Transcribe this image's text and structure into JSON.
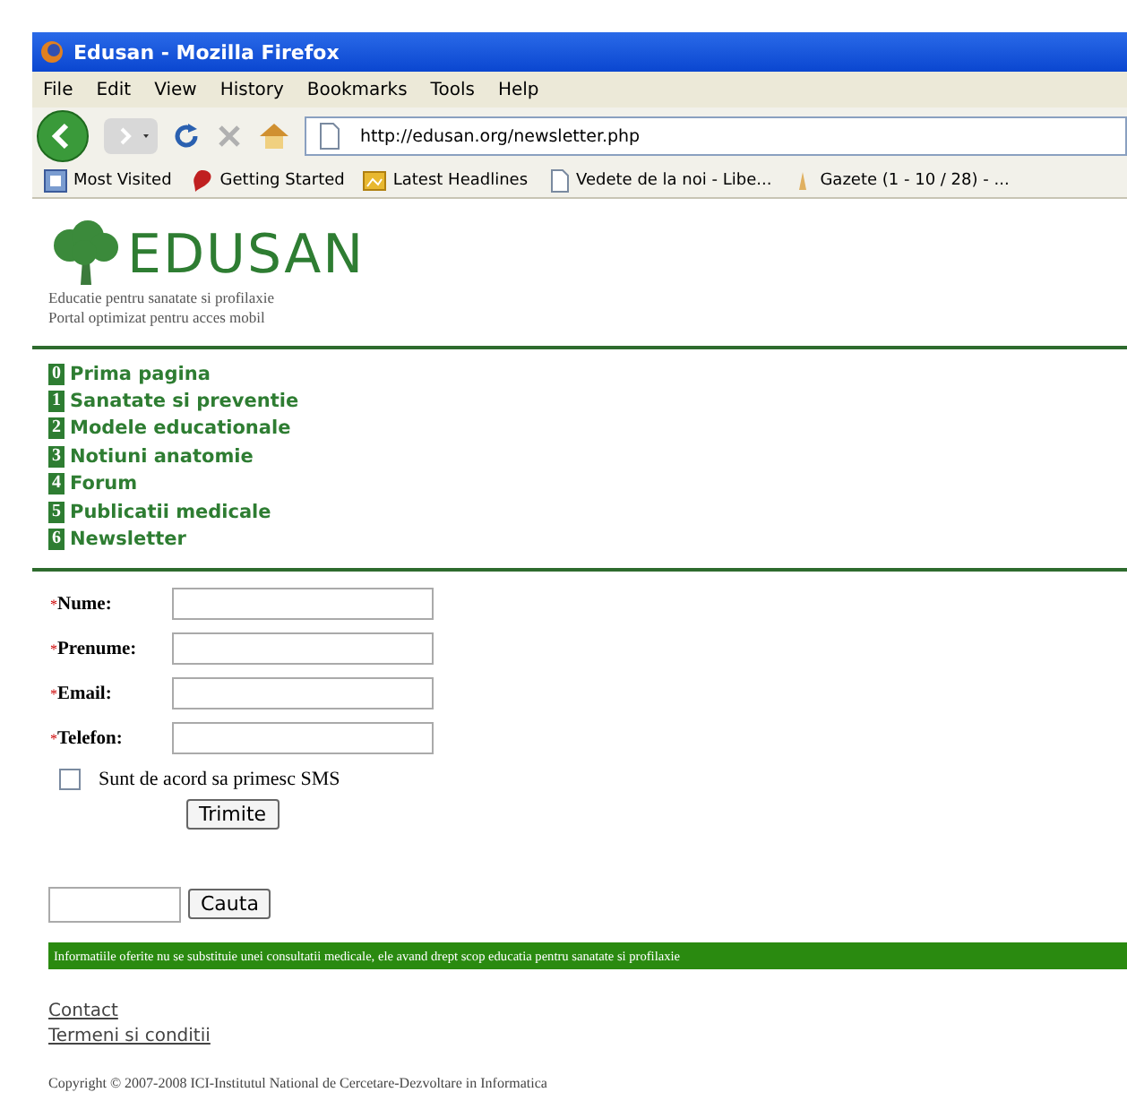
{
  "window": {
    "title": "Edusan - Mozilla Firefox"
  },
  "menu": [
    "File",
    "Edit",
    "View",
    "History",
    "Bookmarks",
    "Tools",
    "Help"
  ],
  "address": {
    "value": "http://edusan.org/newsletter.php"
  },
  "bookmarks": [
    {
      "label": "Most Visited",
      "kind": "smart"
    },
    {
      "label": "Getting Started",
      "kind": "star"
    },
    {
      "label": "Latest Headlines",
      "kind": "feed"
    },
    {
      "label": "Vedete de la noi - Libe...",
      "kind": "page"
    },
    {
      "label": "Gazete (1 - 10 / 28) - ...",
      "kind": "search"
    }
  ],
  "site": {
    "logo": "EDUSAN",
    "taglines": [
      "Educatie pentru sanatate si profilaxie",
      "Portal optimizat pentru acces mobil"
    ]
  },
  "nav": [
    {
      "number": "0",
      "label": "Prima pagina"
    },
    {
      "number": "1",
      "label": "Sanatate si preventie"
    },
    {
      "number": "2",
      "label": "Modele educationale"
    },
    {
      "number": "3",
      "label": "Notiuni anatomie"
    },
    {
      "number": "4",
      "label": "Forum"
    },
    {
      "number": "5",
      "label": "Publicatii medicale"
    },
    {
      "number": "6",
      "label": "Newsletter"
    }
  ],
  "form": {
    "fields": [
      {
        "mark": "*",
        "label": "Nume:"
      },
      {
        "mark": "*",
        "label": "Prenume:"
      },
      {
        "mark": "*",
        "label": "Email:"
      },
      {
        "mark": "*",
        "label": "Telefon:"
      }
    ],
    "sms": {
      "label": "Sunt de acord sa primesc SMS",
      "checked": false
    },
    "submit": "Trimite"
  },
  "search": {
    "button": "Cauta"
  },
  "disclaimer": "Informatiile oferite nu se substituie unei consultatii medicale, ele avand drept scop educatia pentru sanatate si profilaxie",
  "footer_links": [
    "Contact",
    "Termeni si conditii"
  ],
  "copyright": "Copyright © 2007-2008 ICI-Institutul National de Cercetare-Dezvoltare in Informatica"
}
